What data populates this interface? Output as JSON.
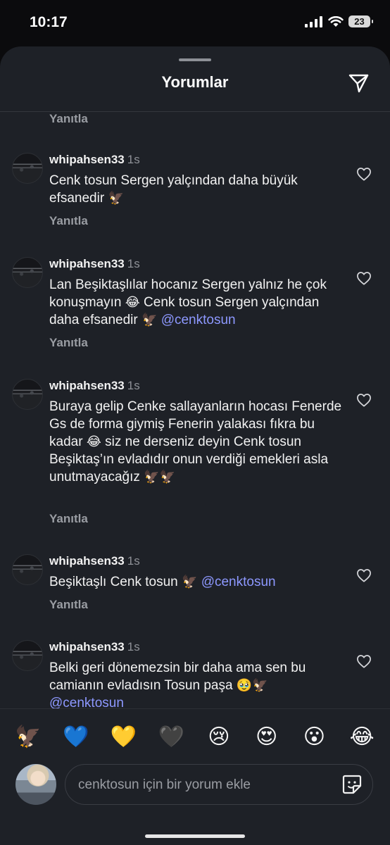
{
  "status_bar": {
    "time": "10:17",
    "battery": "23"
  },
  "header": {
    "title": "Yorumlar"
  },
  "top_reply_label": "Yanıtla",
  "comments": [
    {
      "username": "whipahsen33",
      "time": "1s",
      "text_parts": [
        "Cenk tosun Sergen yalçından daha büyük efsanedir ",
        "🦅"
      ],
      "reply": "Yanıtla"
    },
    {
      "username": "whipahsen33",
      "time": "1s",
      "text_parts": [
        "Lan Beşiktaşlılar hocanız Sergen yalnız he çok konuşmayın ",
        "😂",
        " Cenk tosun Sergen yalçından daha efsanedir ",
        "🦅",
        " ",
        "@cenktosun"
      ],
      "reply": "Yanıtla"
    },
    {
      "username": "whipahsen33",
      "time": "1s",
      "text_parts": [
        "Buraya gelip Cenke sallayanların hocası Fenerde Gs de forma giymiş Fenerin yalakası fıkra bu kadar ",
        "😂",
        " siz ne derseniz deyin Cenk tosun Beşiktaş’ın evladıdır onun verdiği emekleri asla unutmayacağız ",
        "🦅🦅"
      ],
      "reply": "Yanıtla"
    },
    {
      "username": "whipahsen33",
      "time": "1s",
      "text_parts": [
        "Beşiktaşlı Cenk tosun ",
        "🦅",
        " ",
        "@cenktosun"
      ],
      "reply": "Yanıtla"
    },
    {
      "username": "whipahsen33",
      "time": "1s",
      "text_parts": [
        "Belki geri dönemezsin bir daha ama sen bu camianın evladısın Tosun paşa ",
        "🥹🦅",
        " ",
        "@cenktosun"
      ],
      "reply": ""
    }
  ],
  "emoji_bar": [
    "🦅",
    "💙",
    "💛",
    "🖤",
    "😢",
    "😍",
    "😮",
    "😂"
  ],
  "input": {
    "placeholder": "cenktosun için bir yorum ekle",
    "value": ""
  },
  "icons": {
    "send": "paper-plane-icon",
    "like": "heart-outline-icon",
    "sticker": "sticker-icon",
    "signal": "cellular-signal-icon",
    "wifi": "wifi-icon",
    "battery": "battery-icon"
  },
  "colors": {
    "sheet_bg": "#1e2127",
    "mention": "#8d98ff",
    "muted": "#9a9da3"
  }
}
